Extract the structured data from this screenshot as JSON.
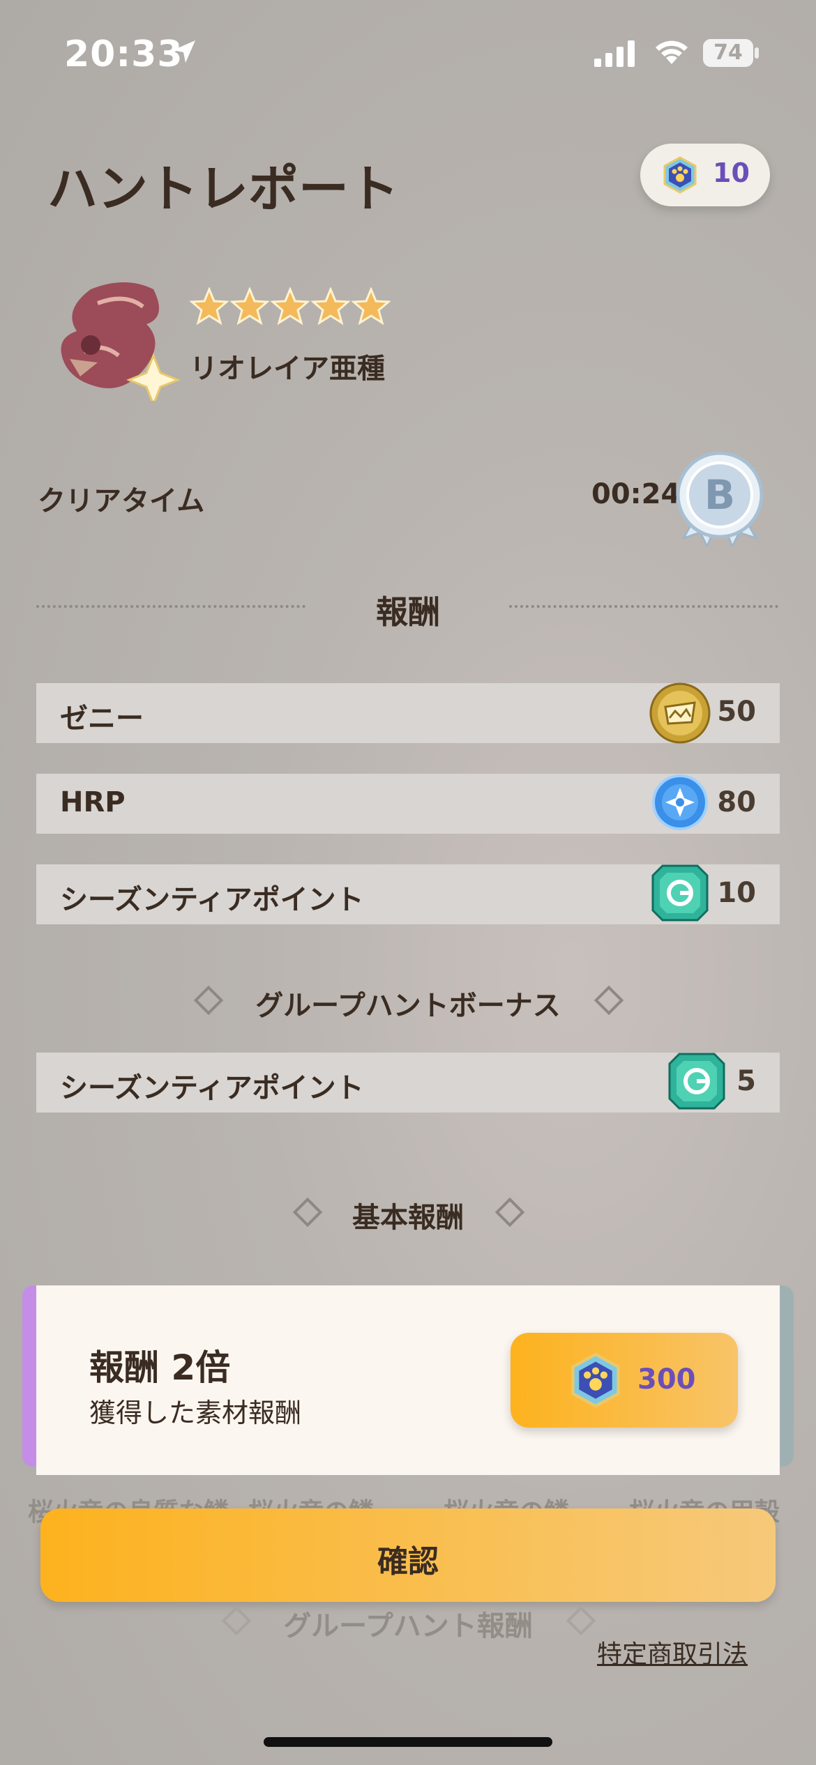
{
  "status_bar": {
    "time": "20:33",
    "battery": "74"
  },
  "header": {
    "title": "ハントレポート",
    "currency_amount": "10",
    "currency_icon": "paw-gem-icon"
  },
  "monster": {
    "name": "リオレイア亜種",
    "stars": 5
  },
  "clear": {
    "label": "クリアタイム",
    "time": "00:24",
    "rank": "B"
  },
  "rewards_section": {
    "title": "報酬"
  },
  "rewards": [
    {
      "label": "ゼニー",
      "value": "50",
      "icon": "zenny-coin-icon"
    },
    {
      "label": "HRP",
      "value": "80",
      "icon": "hrp-orb-icon"
    },
    {
      "label": "シーズンティアポイント",
      "value": "10",
      "icon": "season-tier-gem-icon"
    }
  ],
  "group_bonus": {
    "title": "グループハントボーナス",
    "items": [
      {
        "label": "シーズンティアポイント",
        "value": "5",
        "icon": "season-tier-gem-icon"
      }
    ]
  },
  "base_rewards": {
    "title": "基本報酬"
  },
  "popup": {
    "title": "報酬 2倍",
    "subtitle": "獲得した素材報酬",
    "price": "300"
  },
  "faded_items": [
    "桜火竜の良質な鱗",
    "桜火竜の鱗",
    "桜火竜の鱗",
    "桜火竜の甲殻"
  ],
  "confirm_button": "確認",
  "group_reward_title": "グループハント報酬",
  "legal_link": "特定商取引法",
  "colors": {
    "accent_orange": "#fdb21e",
    "currency_purple": "#6b4fb8",
    "text_dark": "#3a2c22"
  }
}
